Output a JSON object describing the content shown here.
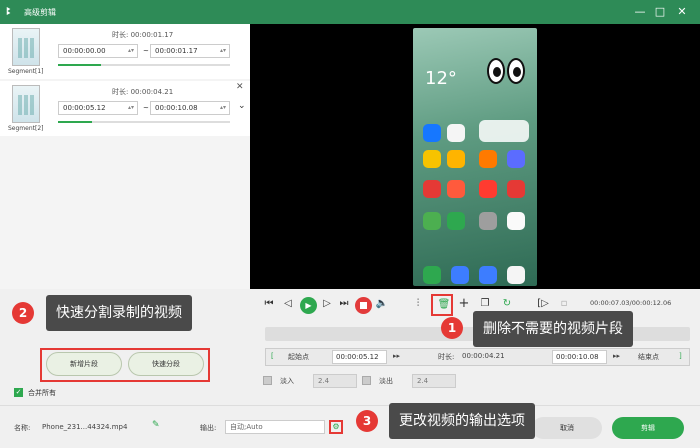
{
  "window": {
    "logo": "ꔪ",
    "title": "高级剪辑",
    "min": "—",
    "max": "□",
    "close": "✕"
  },
  "segments": [
    {
      "label": "Segment[1]",
      "duration_label": "时长:",
      "duration": "00:00:01.17",
      "start": "00:00:00.00",
      "end": "00:00:01.17",
      "sep": "~",
      "progress": 0.25
    },
    {
      "label": "Segment[2]",
      "duration_label": "时长:",
      "duration": "00:00:04.21",
      "start": "00:00:05.12",
      "end": "00:00:10.08",
      "sep": "~",
      "progress": 0.2
    }
  ],
  "phone": {
    "clock": "12°"
  },
  "controls": {
    "time_current": "00:00:07.03",
    "time_total": "00:00:12.06",
    "time_sep": "/"
  },
  "trim": {
    "start_label": "起始点",
    "start_value": "00:00:05.12",
    "duration_label": "时长:",
    "duration_value": "00:00:04.21",
    "end_value": "00:00:10.08",
    "end_label": "结束点",
    "fade_in_label": "淡入",
    "fade_in_value": "2.4",
    "fade_out_label": "淡出",
    "fade_out_value": "2.4"
  },
  "buttons": {
    "new_segment": "新增片段",
    "quick_split": "快速分段",
    "merge_all": "合并所有",
    "cancel": "取消",
    "clip": "剪辑"
  },
  "footer": {
    "name_label": "名称:",
    "file_name": "Phone_231...44324.mp4",
    "output_label": "输出:",
    "output_value": "自动;Auto"
  },
  "callouts": [
    {
      "num": "1",
      "text": "删除不需要的视频片段"
    },
    {
      "num": "2",
      "text": "快速分割录制的视频"
    },
    {
      "num": "3",
      "text": "更改视频的输出选项"
    }
  ],
  "colors": {
    "titlebar": "#2e8b57",
    "accent": "#2ea84f",
    "highlight": "#e53935"
  }
}
